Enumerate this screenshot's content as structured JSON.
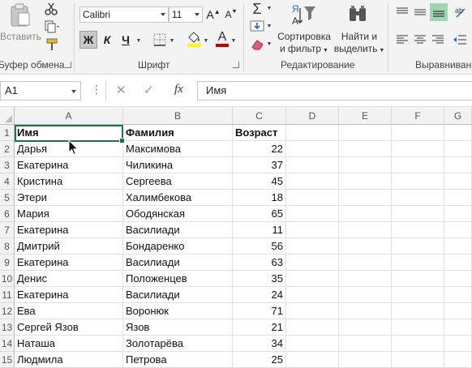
{
  "ribbon": {
    "clipboard": {
      "paste_label": "Вставить",
      "group_label": "Буфер обмена"
    },
    "font": {
      "font_name": "Calibri",
      "font_size": "11",
      "grow_label": "A",
      "shrink_label": "A",
      "bold_label": "Ж",
      "italic_label": "К",
      "underline_label": "Ч",
      "font_color_label": "A",
      "group_label": "Шрифт"
    },
    "editing": {
      "sort_label_1": "Сортировка",
      "sort_label_2": "и фильтр",
      "find_label_1": "Найти и",
      "find_label_2": "выделить",
      "sort_icon_text": "Я",
      "sort_icon_text2": "А",
      "group_label": "Редактирование"
    },
    "alignment": {
      "group_label": "Выравниван"
    },
    "colors": {
      "font_color": "#c00000",
      "accent": "#217346"
    }
  },
  "formula_bar": {
    "name_box": "A1",
    "cancel_icon": "✕",
    "enter_icon": "✓",
    "fx_label": "fx",
    "formula": "Имя"
  },
  "sheet": {
    "columns": [
      "A",
      "B",
      "C",
      "D",
      "E",
      "F",
      "G"
    ],
    "rows": [
      {
        "n": "1",
        "a": "Имя",
        "b": "Фамилия",
        "c": "Возраст"
      },
      {
        "n": "2",
        "a": "Дарья",
        "b": "Максимова",
        "c": "22"
      },
      {
        "n": "3",
        "a": "Екатерина",
        "b": "Чиликина",
        "c": "37"
      },
      {
        "n": "4",
        "a": "Кристина",
        "b": "Сергеева",
        "c": "45"
      },
      {
        "n": "5",
        "a": "Этери",
        "b": "Халимбекова",
        "c": "18"
      },
      {
        "n": "6",
        "a": "Мария",
        "b": "Ободянская",
        "c": "65"
      },
      {
        "n": "7",
        "a": "Екатерина",
        "b": "Василиади",
        "c": "11"
      },
      {
        "n": "8",
        "a": "Дмитрий",
        "b": "Бондаренко",
        "c": "56"
      },
      {
        "n": "9",
        "a": "Екатерина",
        "b": "Василиади",
        "c": "63"
      },
      {
        "n": "10",
        "a": "Денис",
        "b": "Положенцев",
        "c": "35"
      },
      {
        "n": "11",
        "a": "Екатерина",
        "b": "Василиади",
        "c": "24"
      },
      {
        "n": "12",
        "a": "Ева",
        "b": "Воронюк",
        "c": "71"
      },
      {
        "n": "13",
        "a": "Сергей Язов",
        "b": "Язов",
        "c": "21"
      },
      {
        "n": "14",
        "a": "Наташа",
        "b": "Золотарёва",
        "c": "34"
      },
      {
        "n": "15",
        "a": "Людмила",
        "b": "Петрова",
        "c": "25"
      }
    ]
  }
}
